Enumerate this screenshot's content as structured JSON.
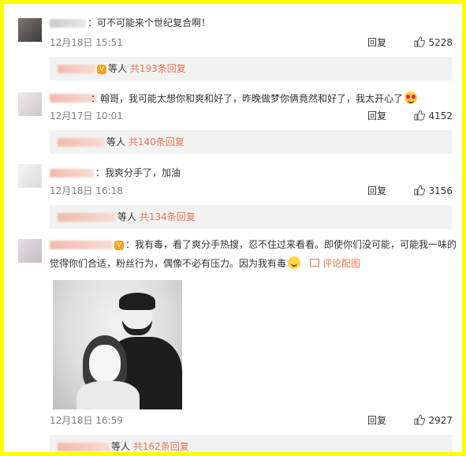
{
  "comments": [
    {
      "text": "：可不可能来个世纪复合啊！",
      "date": "12月18日 15:51",
      "reply_label": "回复",
      "likes": "5228",
      "replies_suffix": "等人",
      "replies_count": "共193条回复"
    },
    {
      "text": "：翰哥，我可能太想你和爽和好了，昨晚做梦你俩竟然和好了，我太开心了",
      "date": "12月17日 10:01",
      "reply_label": "回复",
      "likes": "4152",
      "replies_suffix": "等人",
      "replies_count": "共140条回复"
    },
    {
      "text": "：我爽分手了，加油",
      "date": "12月18日 16:18",
      "reply_label": "回复",
      "likes": "3156",
      "replies_suffix": "等人",
      "replies_count": "共134条回复"
    },
    {
      "text_line1": "：我有毒，看了爽分手热搜，忍不住过来看看。即使你们没可能，可能我一味的",
      "text_line2": "觉得你们合适，粉丝行为，偶像不必有压力。因为我有毒",
      "pic_link": "评论配图",
      "date": "12月18日 16:59",
      "reply_label": "回复",
      "likes": "2927",
      "replies_suffix": "等人",
      "replies_count": "共162条回复"
    }
  ],
  "icons": {
    "like": "thumbs-up-icon",
    "emoji_heart_eyes": "heart-eyes-emoji-icon",
    "emoji_laugh": "laughing-emoji-icon",
    "vip": "vip-badge-icon",
    "picture": "picture-icon"
  },
  "colors": {
    "frame": "#ffff00",
    "accent": "#eb7350",
    "replies_bg": "#f2f2f2",
    "meta_text": "#808080"
  }
}
